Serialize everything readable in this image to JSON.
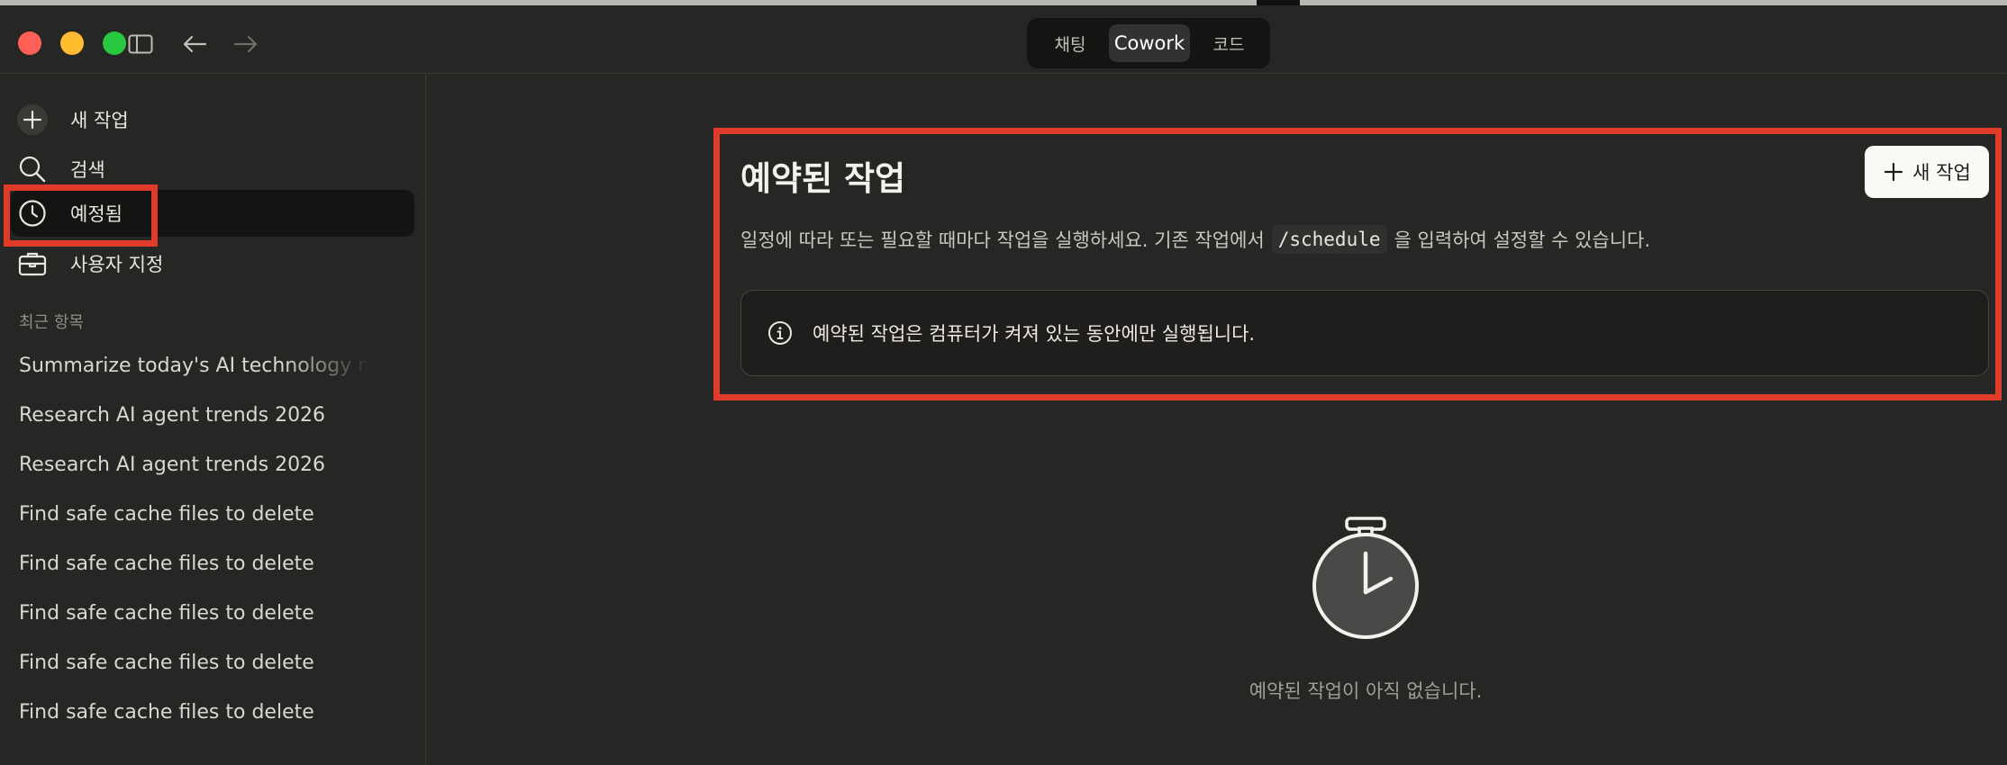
{
  "window": {
    "mode_tabs": [
      "채팅",
      "Cowork",
      "코드"
    ],
    "active_mode": "Cowork",
    "traffic_light_colors": [
      "#ff5f57",
      "#febc2e",
      "#28c840"
    ]
  },
  "sidebar": {
    "nav": [
      {
        "label": "새 작업",
        "icon": "plus-icon"
      },
      {
        "label": "검색",
        "icon": "search-icon"
      },
      {
        "label": "예정됨",
        "icon": "clock-icon",
        "selected": true
      },
      {
        "label": "사용자 지정",
        "icon": "briefcase-icon"
      }
    ],
    "recents_label": "최근 항목",
    "recents": [
      "Summarize today's AI technology news",
      "Research AI agent trends 2026",
      "Research AI agent trends 2026",
      "Find safe cache files to delete",
      "Find safe cache files to delete",
      "Find safe cache files to delete",
      "Find safe cache files to delete",
      "Find safe cache files to delete"
    ]
  },
  "main": {
    "title": "예약된 작업",
    "new_button_label": "새 작업",
    "description_before": "일정에 따라 또는 필요할 때마다 작업을 실행하세요. 기존 작업에서",
    "description_code": "/schedule",
    "description_after": "을 입력하여 설정할 수 있습니다.",
    "info_text": "예약된 작업은 컴퓨터가 켜져 있는 동안에만 실행됩니다.",
    "empty_state_text": "예약된 작업이 아직 없습니다.",
    "empty_state_icon": "stopwatch-icon"
  },
  "colors": {
    "background": "#262624",
    "highlight_outline": "#e03a28",
    "button_bg": "#faf9f5"
  }
}
